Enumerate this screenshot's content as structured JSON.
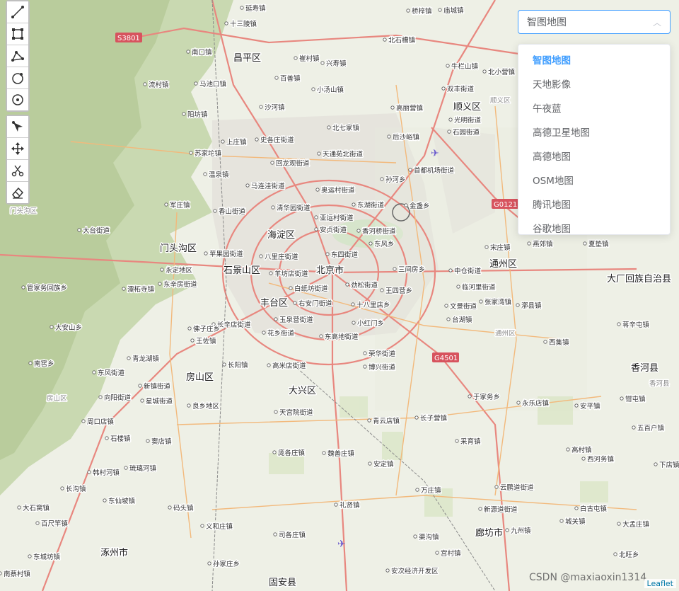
{
  "basemap_select": {
    "value": "智图地图",
    "options": [
      "智图地图",
      "天地影像",
      "午夜蓝",
      "高德卫星地图",
      "高德地图",
      "OSM地图",
      "腾讯地图",
      "谷歌地图"
    ]
  },
  "toolbar": {
    "draw_tools": [
      "polyline-icon",
      "rectangle-icon",
      "polygon-icon",
      "circle-icon",
      "marker-icon"
    ],
    "edit_tools": [
      "edit-icon",
      "move-icon",
      "cut-icon",
      "eraser-icon"
    ]
  },
  "map": {
    "districts": [
      "昌平区",
      "海淀区",
      "北京市",
      "石景山区",
      "丰台区",
      "门头沟区",
      "房山区",
      "大兴区",
      "顺义区",
      "通州区",
      "廊坊市",
      "涿州市",
      "固安县",
      "香河县",
      "大厂回族自治县"
    ],
    "places": [
      "延寿镇",
      "十三陵镇",
      "南口镇",
      "崔村镇",
      "兴寿镇",
      "北石槽镇",
      "桥梓镇",
      "庙城镇",
      "百善镇",
      "马池口镇",
      "流村镇",
      "小汤山镇",
      "沙河镇",
      "阳坊镇",
      "北七家镇",
      "高丽营镇",
      "牛栏山镇",
      "北小营镇",
      "双丰街道",
      "光明街道",
      "石园街道",
      "后沙峪镇",
      "史各庄街道",
      "上庄镇",
      "苏家坨镇",
      "回龙观街道",
      "天通苑北街道",
      "温泉镇",
      "马连洼街道",
      "奥运村街道",
      "孙河乡",
      "首都机场街道",
      "东湖街道",
      "金盏乡",
      "清华园街道",
      "香山街道",
      "军庄镇",
      "亚运村街道",
      "安贞街道",
      "香河桥街道",
      "东风乡",
      "八里庄街道",
      "东四街道",
      "苹果园街道",
      "永定地区",
      "大台街道",
      "三间房乡",
      "中仓街道",
      "宋庄镇",
      "燕郊镇",
      "夏垫镇",
      "东辛房街道",
      "羊坊店街道",
      "白纸坊街道",
      "劲松街道",
      "王四营乡",
      "临河里街道",
      "潭柘寺镇",
      "右安门街道",
      "十八里店乡",
      "文景街道",
      "张家湾镇",
      "漷县镇",
      "长辛店街道",
      "玉泉营街道",
      "小红门乡",
      "台湖镇",
      "王佐镇",
      "花乡街道",
      "东高地街道",
      "荣华街道",
      "博兴街道",
      "西集镇",
      "南窖乡",
      "青龙湖镇",
      "长阳镇",
      "高米店街道",
      "蒋辛屯镇",
      "东风街道",
      "新镇街道",
      "向阳街道",
      "星城街道",
      "良乡地区",
      "天宫院街道",
      "于家务乡",
      "永乐店镇",
      "钳屯镇",
      "安平镇",
      "周口店镇",
      "青云店镇",
      "长子营镇",
      "五百户镇",
      "石楼镇",
      "窦店镇",
      "采育镇",
      "高村镇",
      "韩村河镇",
      "琉璃河镇",
      "庞各庄镇",
      "魏善庄镇",
      "安定镇",
      "西河务镇",
      "下店镇",
      "长沟镇",
      "万庄镇",
      "云鹏道街道",
      "东仙坡镇",
      "礼贤镇",
      "新源道街道",
      "白古屯镇",
      "大石窝镇",
      "码头镇",
      "城关镇",
      "百尺竿镇",
      "义和庄镇",
      "大孟庄镇",
      "东城坊镇",
      "司各庄镇",
      "渠沟镇",
      "九州镇",
      "北旺乡",
      "南蔡村镇",
      "孙家庄乡",
      "宫村镇",
      "安次经济开发区",
      "管家务回族乡",
      "大安山乡",
      "佛子庄乡",
      "王平镇"
    ],
    "grey_labels": [
      "门头沟区",
      "房山区",
      "顺义区",
      "通州区",
      "香河县"
    ],
    "highway_shields": [
      "S3801",
      "G0121",
      "G4501"
    ]
  },
  "watermark": "CSDN @maxiaoxin1314",
  "attribution": "Leaflet"
}
